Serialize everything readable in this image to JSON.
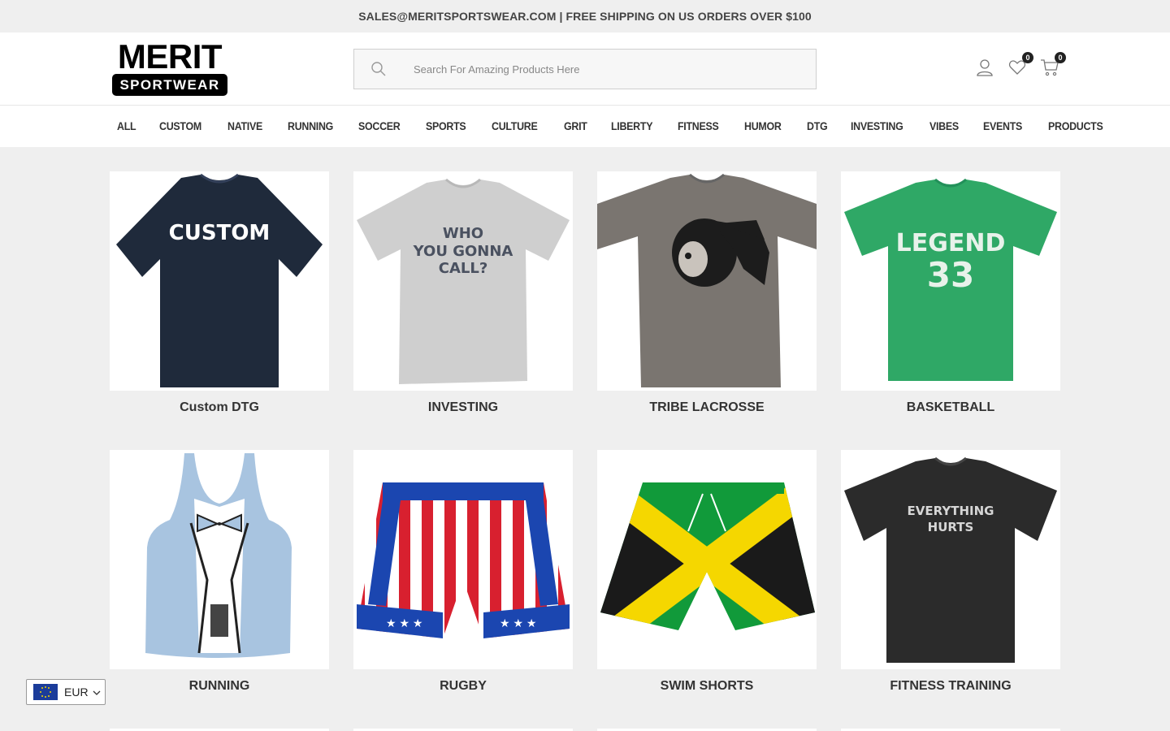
{
  "topbar": {
    "text": "SALES@MERITSPORTSWEAR.COM | FREE SHIPPING ON US ORDERS OVER $100"
  },
  "header": {
    "logo_top": "MERIT",
    "logo_bottom": "SPORTWEAR",
    "search_placeholder": "Search For Amazing Products Here",
    "wishlist_count": "0",
    "cart_count": "0"
  },
  "nav": {
    "items": [
      "ALL",
      "CUSTOM",
      "NATIVE",
      "RUNNING",
      "SOCCER",
      "SPORTS",
      "CULTURE",
      "GRIT",
      "LIBERTY",
      "FITNESS",
      "HUMOR",
      "DTG",
      "INVESTING",
      "VIBES",
      "EVENTS",
      "PRODUCTS"
    ]
  },
  "products": [
    {
      "title": "Custom DTG",
      "shirt_text": "CUSTOM",
      "color": "#1f2a3b"
    },
    {
      "title": "INVESTING",
      "shirt_text": "WHO YOU GONNA CALL?",
      "color": "#cfcfcf"
    },
    {
      "title": "TRIBE LACROSSE",
      "shirt_text": "",
      "color": "#7a7570"
    },
    {
      "title": "BASKETBALL",
      "shirt_text": "LEGEND 33",
      "color": "#2fa866"
    },
    {
      "title": "RUNNING",
      "shirt_text": "",
      "color": "#a8c4e0"
    },
    {
      "title": "RUGBY",
      "shirt_text": "",
      "color": "#d8202f"
    },
    {
      "title": "SWIM SHORTS",
      "shirt_text": "",
      "color": "#119a3a"
    },
    {
      "title": "FITNESS TRAINING",
      "shirt_text": "EVERYTHING HURTS",
      "color": "#2b2b2b"
    }
  ],
  "currency": {
    "code": "EUR"
  }
}
